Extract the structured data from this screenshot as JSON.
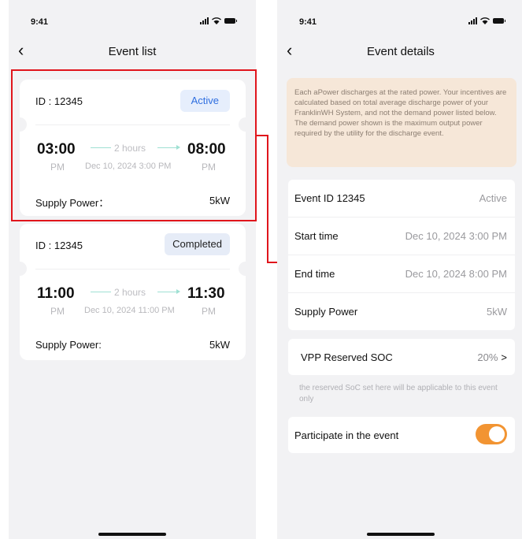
{
  "status": {
    "time": "9:41"
  },
  "left": {
    "title": "Event list",
    "events": [
      {
        "id_label": "ID : 12345",
        "status": "Active",
        "start_time": "03:00",
        "start_period": "PM",
        "duration": "2 hours",
        "date_line": "Dec 10, 2024 3:00 PM",
        "end_time": "08:00",
        "end_period": "PM",
        "supply_label": "Supply Power：",
        "supply_value": "5kW"
      },
      {
        "id_label": "ID : 12345",
        "status": "Completed",
        "start_time": "11:00",
        "start_period": "PM",
        "duration": "2 hours",
        "date_line": "Dec 10, 2024 11:00 PM",
        "end_time": "11:30",
        "end_period": "PM",
        "supply_label": "Supply Power:",
        "supply_value": "5kW"
      }
    ]
  },
  "right": {
    "title": "Event details",
    "notice": "Each aPower discharges at the rated power. Your incentives are calculated based on total average discharge power of your FranklinWH System, and not the demand power listed below. The demand power shown is the maximum output power required by the utility for the discharge event.",
    "details": [
      {
        "label": "Event ID 12345",
        "value": "Active"
      },
      {
        "label": "Start time",
        "value": "Dec 10, 2024 3:00 PM"
      },
      {
        "label": "End time",
        "value": "Dec 10, 2024 8:00 PM"
      },
      {
        "label": "Supply Power",
        "value": "5kW"
      }
    ],
    "vpp": {
      "label": "VPP Reserved SOC",
      "value": "20%",
      "chevron": ">"
    },
    "vpp_hint": "the reserved SoC set here will be applicable to this event only",
    "participate": {
      "label": "Participate in the event",
      "on": true
    }
  },
  "colors": {
    "highlight": "#e0151c",
    "toggle": "#f29432",
    "active_badge": "#2f6fe0",
    "notice_bg": "#f6e7d8"
  }
}
